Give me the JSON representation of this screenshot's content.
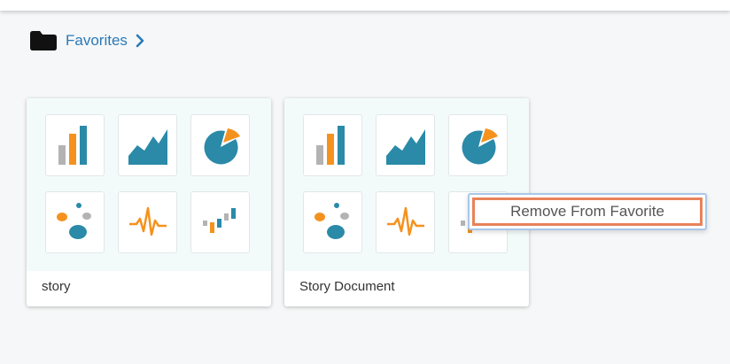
{
  "breadcrumb": {
    "icon": "folder-icon",
    "label": "Favorites",
    "chevron": "chevron-right-icon"
  },
  "colors": {
    "accent_link": "#2a7ab8",
    "teal": "#2a8aa8",
    "orange": "#f5921e",
    "gray": "#b3b3b3",
    "menu_highlight": "#e8825a"
  },
  "cards": [
    {
      "name": "story",
      "icons": [
        "bar-chart-icon",
        "area-chart-icon",
        "pie-chart-icon",
        "bubble-chart-icon",
        "pulse-line-icon",
        "waterfall-chart-icon"
      ]
    },
    {
      "name": "Story Document",
      "icons": [
        "bar-chart-icon",
        "area-chart-icon",
        "pie-chart-icon",
        "bubble-chart-icon",
        "pulse-line-icon",
        "waterfall-chart-icon"
      ]
    }
  ],
  "context_menu": {
    "items": [
      {
        "label": "Remove From Favorite"
      }
    ]
  }
}
